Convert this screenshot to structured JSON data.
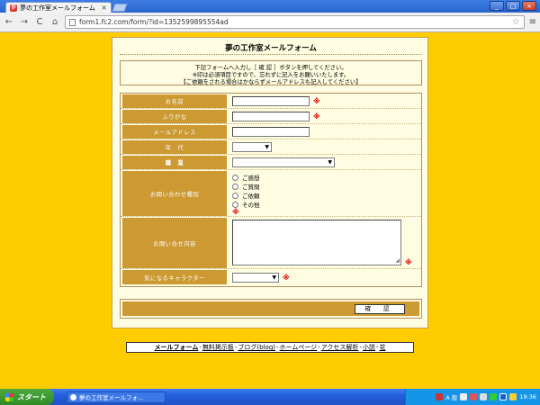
{
  "browser": {
    "tab_title": "夢の工作室メールフォーム",
    "tab_close": "×",
    "url": "form1.fc2.com/form/?id=1352599895554ad",
    "back": "←",
    "forward": "→",
    "reload": "C",
    "home": "⌂",
    "star": "☆",
    "menu": "≡",
    "win_min": "_",
    "win_max": "□",
    "win_close": "×"
  },
  "form": {
    "title": "夢の工作室メールフォーム",
    "intro_lines": [
      "下記フォームへ入力し［ 確 認 ］ボタンを押してください。",
      "※印は必須項目ですので、忘れずに記入をお願いいたします。",
      "【ご依頼をされる場合はかならずメールアドレスも記入してください】"
    ],
    "fields": {
      "name": {
        "label": "お名前"
      },
      "furigana": {
        "label": "ふりがな"
      },
      "email": {
        "label": "メールアドレス"
      },
      "age": {
        "label": "年　代",
        "selected": "▼"
      },
      "job": {
        "label": "職　業",
        "selected": "▼"
      },
      "inquiry_type": {
        "label": "お問い合わせ種別",
        "options": [
          "ご感想",
          "ご質問",
          "ご依頼",
          "その他"
        ]
      },
      "inquiry_body": {
        "label": "お問い合せ内容"
      },
      "character": {
        "label": "気になるキャラクター",
        "selected": "▼"
      }
    },
    "required_mark": "※",
    "submit_label": "確 認"
  },
  "footer": {
    "links": [
      "メールフォーム",
      "無料掲示板",
      "ブログ(blog)",
      "ホームページ",
      "アクセス解析",
      "小説",
      "花"
    ],
    "separator": "-"
  },
  "taskbar": {
    "start_label": "スタート",
    "task_title": "夢の工作室メールフォ...",
    "tray_text": "A 般",
    "clock": "19:36"
  }
}
